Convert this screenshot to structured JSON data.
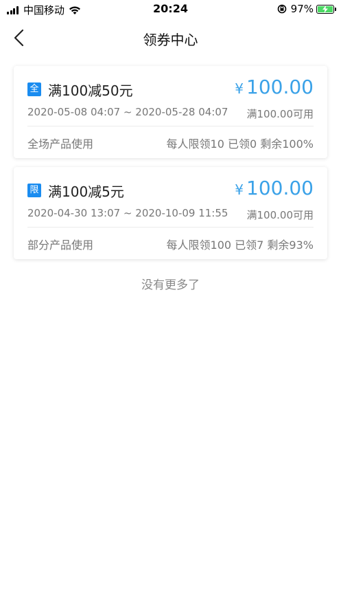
{
  "status_bar": {
    "carrier": "中国移动",
    "time": "20:24",
    "battery_percent": "97%",
    "icons": [
      "signal-icon",
      "wifi-icon",
      "orientation-lock-icon",
      "battery-charging-icon"
    ]
  },
  "nav": {
    "title": "领券中心",
    "back_icon": "chevron-left-icon"
  },
  "coupons": [
    {
      "tag": "全",
      "name": "满100减50元",
      "currency": "¥",
      "amount": "100.00",
      "validity": "2020-05-08 04:07 ~ 2020-05-28 04:07",
      "condition": "满100.00可用",
      "scope": "全场产品使用",
      "limit": "每人限领10 已领0 剩余100%"
    },
    {
      "tag": "限",
      "name": "满100减5元",
      "currency": "¥",
      "amount": "100.00",
      "validity": "2020-04-30 13:07 ~ 2020-10-09 11:55",
      "condition": "满100.00可用",
      "scope": "部分产品使用",
      "limit": "每人限领100 已领7 剩余93%"
    }
  ],
  "footer": {
    "no_more": "没有更多了"
  },
  "colors": {
    "accent": "#3ba2e8",
    "tag_bg": "#1a8cf0",
    "battery": "#4cd964"
  }
}
